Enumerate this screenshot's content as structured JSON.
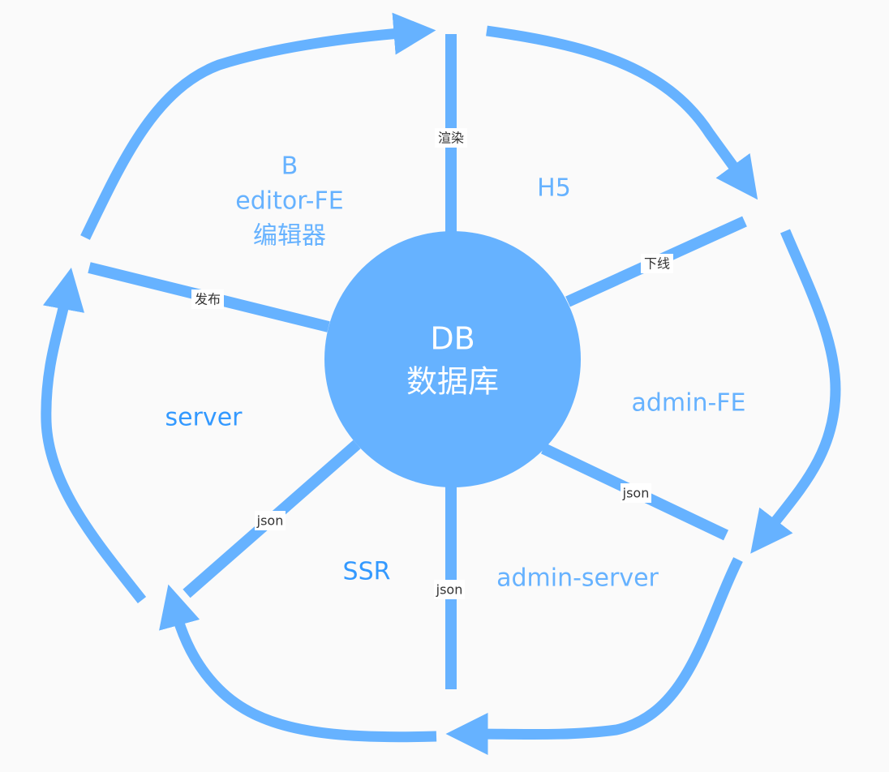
{
  "colors": {
    "primary": "#66b2ff",
    "secondary": "#3399ff",
    "background": "#fafafa"
  },
  "center": {
    "line1": "DB",
    "line2": "数据库"
  },
  "nodes": {
    "editor": {
      "line1": "B",
      "line2": "editor-FE",
      "line3": "编辑器"
    },
    "h5": "H5",
    "admin_fe": "admin-FE",
    "admin_server": "admin-server",
    "ssr": "SSR",
    "server": "server"
  },
  "edges": {
    "render": "渲染",
    "offline": "下线",
    "publish": "发布",
    "json_server": "json",
    "json_ssr": "json",
    "json_admin": "json"
  }
}
